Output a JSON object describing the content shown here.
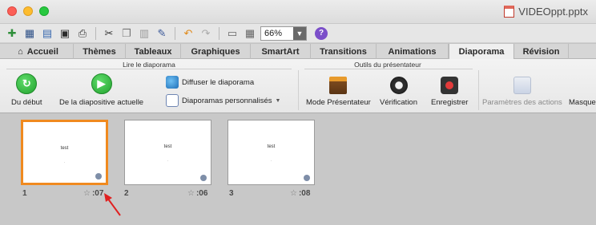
{
  "window": {
    "title": "VIDEOppt.pptx"
  },
  "quickbar": {
    "icons": [
      "new-icon",
      "templates-icon",
      "open-icon",
      "save-icon",
      "print-icon",
      "cut-icon",
      "copy-icon",
      "paste-icon",
      "format-painter-icon",
      "undo-icon",
      "redo-icon",
      "slide-icon",
      "table-icon",
      "help-icon"
    ],
    "zoom": "66%"
  },
  "tabs": [
    {
      "label": "Accueil",
      "icon": "home-icon"
    },
    {
      "label": "Thèmes"
    },
    {
      "label": "Tableaux"
    },
    {
      "label": "Graphiques"
    },
    {
      "label": "SmartArt"
    },
    {
      "label": "Transitions"
    },
    {
      "label": "Animations"
    },
    {
      "label": "Diaporama",
      "active": true
    },
    {
      "label": "Révision"
    }
  ],
  "ribbon": {
    "group_play": {
      "title": "Lire le diaporama",
      "from_start": "Du début",
      "from_current": "De la diapositive actuelle",
      "broadcast": "Diffuser le diaporama",
      "custom_shows": "Diaporamas personnalisés"
    },
    "group_presenter": {
      "title": "Outils du présentateur",
      "presenter_mode": "Mode Présentateur",
      "rehearse": "Vérification",
      "record": "Enregistrer"
    },
    "action_settings": "Paramètres des actions",
    "hide": "Masque"
  },
  "slides": [
    {
      "number": "1",
      "title": "test",
      "subtitle": "·",
      "time": ":07",
      "selected": true
    },
    {
      "number": "2",
      "title": "test",
      "subtitle": "·",
      "time": ":06",
      "selected": false
    },
    {
      "number": "3",
      "title": "test",
      "subtitle": "·",
      "time": ":08",
      "selected": false
    }
  ],
  "colors": {
    "selection_border": "#f08a1f",
    "annotation_arrow": "#e02020"
  }
}
